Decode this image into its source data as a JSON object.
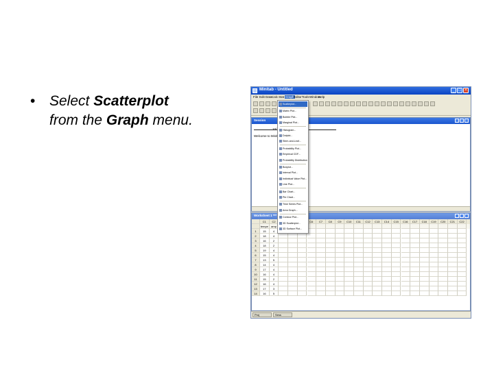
{
  "slide": {
    "bullet": "•",
    "text_prefix": "Select ",
    "text_bold1": "Scatterplot",
    "text_mid": " from the ",
    "text_bold2": "Graph",
    "text_suffix": " menu."
  },
  "window": {
    "title": "Minitab - Untitled"
  },
  "menubar": {
    "items": [
      "File",
      "Edit",
      "Data",
      "Calc",
      "Stat",
      "Graph",
      "Editor",
      "Tools",
      "Window",
      "Help"
    ],
    "active": "Graph"
  },
  "session": {
    "title": "Session",
    "date": "10/19/2007",
    "welcome": "Welcome to Minitab, press F1 for help."
  },
  "worksheet": {
    "title": "Worksheet 1 ***",
    "columns": [
      "C1",
      "C2",
      "C3",
      "C4",
      "C5",
      "C6",
      "C7",
      "C8",
      "C9",
      "C10",
      "C11",
      "C12",
      "C13",
      "C14",
      "C15",
      "C16",
      "C17",
      "C18",
      "C19",
      "C20",
      "C21",
      "C22"
    ],
    "names": [
      "tempe",
      "amp"
    ],
    "rows": [
      [
        "1",
        "15",
        "4"
      ],
      [
        "2",
        "18",
        "4"
      ],
      [
        "3",
        "16",
        "2"
      ],
      [
        "4",
        "18",
        "2"
      ],
      [
        "5",
        "19",
        "4"
      ],
      [
        "6",
        "15",
        "4"
      ],
      [
        "7",
        "13",
        "5"
      ],
      [
        "8",
        "14",
        "4"
      ],
      [
        "9",
        "17",
        "4"
      ],
      [
        "10",
        "16",
        "4"
      ],
      [
        "11",
        "15",
        "2"
      ],
      [
        "12",
        "16",
        "4"
      ],
      [
        "13",
        "17",
        "3"
      ],
      [
        "14",
        "16",
        "5"
      ]
    ]
  },
  "graph_menu": {
    "items": [
      "Scatterplot...",
      "Matrix Plot...",
      "Bubble Plot...",
      "Marginal Plot...",
      "Histogram...",
      "Dotplot...",
      "Stem-and-Leaf...",
      "Probability Plot...",
      "Empirical CDF...",
      "Probability Distribution Plot...",
      "Boxplot...",
      "Interval Plot...",
      "Individual Value Plot...",
      "Line Plot...",
      "Bar Chart...",
      "Pie Chart...",
      "Time Series Plot...",
      "Area Graph...",
      "Contour Plot...",
      "3D Scatterplot...",
      "3D Surface Plot..."
    ],
    "selected": "Scatterplot..."
  },
  "taskbar": {
    "tabs": [
      "Proj",
      "Sess"
    ]
  }
}
